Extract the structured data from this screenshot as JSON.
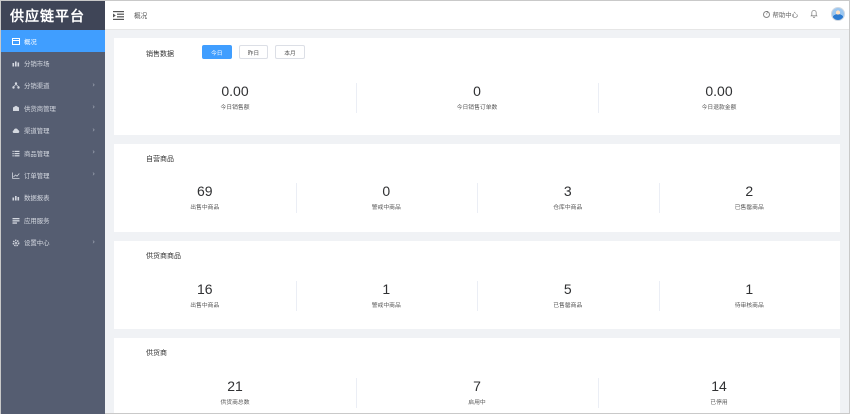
{
  "app": {
    "title": "供应链平台"
  },
  "sidebar": {
    "items": [
      {
        "label": "概况",
        "icon": "dashboard-icon",
        "active": true,
        "has_children": false
      },
      {
        "label": "分销市场",
        "icon": "market-icon",
        "active": false,
        "has_children": false
      },
      {
        "label": "分销渠道",
        "icon": "channel-icon",
        "active": false,
        "has_children": true
      },
      {
        "label": "供货商管理",
        "icon": "supplier-icon",
        "active": false,
        "has_children": true
      },
      {
        "label": "渠道管理",
        "icon": "cloud-icon",
        "active": false,
        "has_children": true
      },
      {
        "label": "商品管理",
        "icon": "list-icon",
        "active": false,
        "has_children": true
      },
      {
        "label": "订单管理",
        "icon": "trend-icon",
        "active": false,
        "has_children": true
      },
      {
        "label": "数据报表",
        "icon": "report-icon",
        "active": false,
        "has_children": false
      },
      {
        "label": "应用服务",
        "icon": "service-icon",
        "active": false,
        "has_children": false
      },
      {
        "label": "设置中心",
        "icon": "gear-icon",
        "active": false,
        "has_children": true
      }
    ]
  },
  "header": {
    "breadcrumb": "概况",
    "help_label": "帮助中心"
  },
  "sales": {
    "title": "销售数据",
    "tabs": [
      {
        "label": "今日",
        "active": true
      },
      {
        "label": "昨日",
        "active": false
      },
      {
        "label": "本月",
        "active": false
      }
    ],
    "stats": [
      {
        "value": "0.00",
        "label": "今日销售额"
      },
      {
        "value": "0",
        "label": "今日销售订单数"
      },
      {
        "value": "0.00",
        "label": "今日退款金额"
      }
    ]
  },
  "own_goods": {
    "title": "自营商品",
    "stats": [
      {
        "value": "69",
        "label": "出售中商品"
      },
      {
        "value": "0",
        "label": "警戒中商品"
      },
      {
        "value": "3",
        "label": "仓库中商品"
      },
      {
        "value": "2",
        "label": "已售罄商品"
      }
    ]
  },
  "supplier_goods": {
    "title": "供货商商品",
    "stats": [
      {
        "value": "16",
        "label": "出售中商品"
      },
      {
        "value": "1",
        "label": "警戒中商品"
      },
      {
        "value": "5",
        "label": "已售罄商品"
      },
      {
        "value": "1",
        "label": "待审核商品"
      }
    ]
  },
  "suppliers": {
    "title": "供货商",
    "stats": [
      {
        "value": "21",
        "label": "供货商总数"
      },
      {
        "value": "7",
        "label": "启用中"
      },
      {
        "value": "14",
        "label": "已停用"
      }
    ]
  },
  "colors": {
    "sidebar_bg": "#555d71",
    "logo_bg": "#3f4557",
    "accent": "#409eff"
  }
}
